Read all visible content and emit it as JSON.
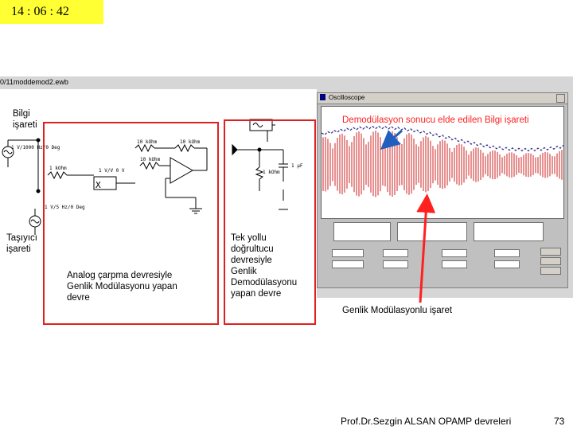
{
  "clock": {
    "time": "14 : 06 : 42"
  },
  "simulator": {
    "window_title": "0/11moddemod2.ewb"
  },
  "oscilloscope": {
    "title": "Oscilloscope"
  },
  "labels": {
    "bilgi": "Bilgi\nişareti",
    "tasiyici": "Taşıyıcı\nişareti",
    "analog": "Analog çarpma devresiyle\nGenlik Modülasyonu yapan\ndevre",
    "tek_yollu": "Tek yollu\ndoğrultucu\ndevresiyle\nGenlik\nDemodülasyonu\nyapan devre",
    "demod_result": "Demodülasyon sonucu elde edilen Bilgi işareti",
    "am_signal": "Genlik Modülasyonlu işaret"
  },
  "footer": {
    "author": "Prof.Dr.Sezgin ALSAN  OPAMP devreleri",
    "page": "73"
  },
  "colors": {
    "clock_bg": "#ffff33",
    "frame_red": "#e02020",
    "trace_red": "#cc2222",
    "envelope_blue": "#2a2a8a",
    "arrow_blue": "#1f5fbf",
    "label_red": "#ff2020"
  }
}
